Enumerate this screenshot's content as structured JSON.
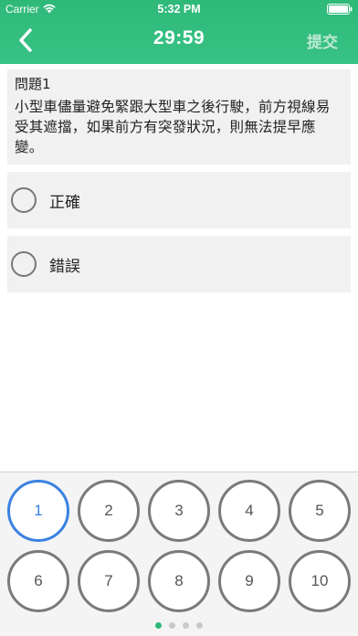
{
  "status_bar": {
    "carrier": "Carrier",
    "time": "5:32 PM"
  },
  "nav": {
    "timer": "29:59",
    "submit_label": "提交"
  },
  "question": {
    "number_label": "問題1",
    "text": "小型車儘量避免緊跟大型車之後行駛，前方視線易受其遮擋，如果前方有突發狀況，則無法提早應變。"
  },
  "options": [
    {
      "label": "正確"
    },
    {
      "label": "錯誤"
    }
  ],
  "question_buttons": [
    "1",
    "2",
    "3",
    "4",
    "5",
    "6",
    "7",
    "8",
    "9",
    "10"
  ],
  "active_question_index": 0,
  "pagination": {
    "pages": 4,
    "current": 1
  },
  "colors": {
    "header_green": "#2fb979",
    "active_blue": "#3b82e0",
    "submit_disabled": "#bfe9d3"
  }
}
